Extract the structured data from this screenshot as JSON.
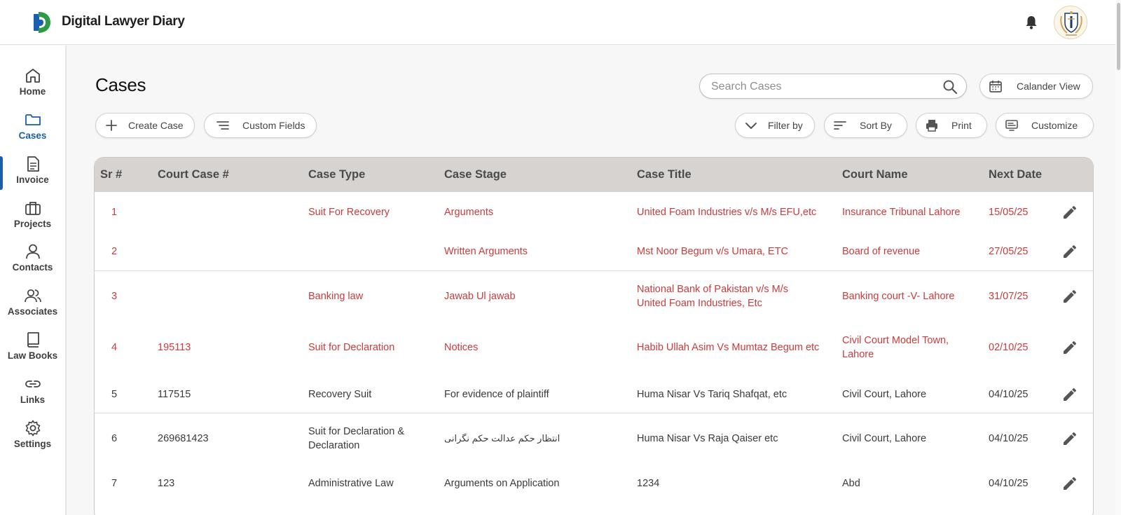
{
  "app": {
    "title": "Digital Lawyer Diary"
  },
  "sidebar": {
    "items": [
      {
        "label": "Home",
        "icon": "home-icon"
      },
      {
        "label": "Cases",
        "icon": "folder-icon",
        "active": true
      },
      {
        "label": "Invoice",
        "icon": "document-icon"
      },
      {
        "label": "Projects",
        "icon": "briefcase-icon"
      },
      {
        "label": "Contacts",
        "icon": "person-icon"
      },
      {
        "label": "Associates",
        "icon": "people-icon"
      },
      {
        "label": "Law Books",
        "icon": "book-icon"
      },
      {
        "label": "Links",
        "icon": "link-icon"
      },
      {
        "label": "Settings",
        "icon": "gear-icon"
      }
    ]
  },
  "page": {
    "title": "Cases"
  },
  "search": {
    "placeholder": "Search Cases",
    "value": ""
  },
  "toolbar": {
    "calendar_view": "Calander View",
    "create_case": "Create Case",
    "custom_fields": "Custom Fields",
    "filter_by": "Filter by",
    "sort_by": "Sort By",
    "print": "Print",
    "customize": "Customize"
  },
  "table": {
    "columns": [
      "Sr #",
      "Court Case #",
      "Case Type",
      "Case Stage",
      "Case Title",
      "Court Name",
      "Next Date"
    ],
    "rows": [
      {
        "sr": "1",
        "court_case": "",
        "case_type": "Suit For Recovery",
        "case_stage": "Arguments",
        "case_title": "United Foam Industries v/s M/s EFU,etc",
        "court_name": "Insurance Tribunal Lahore",
        "next_date": "15/05/25",
        "highlight": true
      },
      {
        "sr": "2",
        "court_case": "",
        "case_type": "",
        "case_stage": "Written Arguments",
        "case_title": "Mst Noor Begum v/s Umara, ETC",
        "court_name": "Board of revenue",
        "next_date": "27/05/25",
        "highlight": true
      },
      {
        "sr": "3",
        "court_case": "",
        "case_type": "Banking law",
        "case_stage": "Jawab Ul jawab",
        "case_title": "National Bank of Pakistan v/s M/s United Foam Industries, Etc",
        "court_name": "Banking court -V- Lahore",
        "next_date": "31/07/25",
        "highlight": true
      },
      {
        "sr": "4",
        "court_case": "195113",
        "case_type": "Suit for Declaration",
        "case_stage": "Notices",
        "case_title": "Habib Ullah Asim Vs Mumtaz Begum etc",
        "court_name": "Civil Court Model Town, Lahore",
        "next_date": "02/10/25",
        "highlight": true
      },
      {
        "sr": "5",
        "court_case": "117515",
        "case_type": "Recovery Suit",
        "case_stage": "For evidence of plaintiff",
        "case_title": "Huma Nisar Vs Tariq Shafqat, etc",
        "court_name": "Civil Court, Lahore",
        "next_date": "04/10/25",
        "highlight": false
      },
      {
        "sr": "6",
        "court_case": "269681423",
        "case_type": "Suit for Declaration & Declaration",
        "case_stage": "انتظار حکم عدالت حکم نگرانی",
        "case_title": "Huma Nisar Vs Raja Qaiser etc",
        "court_name": "Civil Court, Lahore",
        "next_date": "04/10/25",
        "highlight": false
      },
      {
        "sr": "7",
        "court_case": "123",
        "case_type": "Administrative Law",
        "case_stage": "Arguments on Application",
        "case_title": "1234",
        "court_name": "Abd",
        "next_date": "04/10/25",
        "highlight": false
      }
    ]
  },
  "colors": {
    "accent": "#1a5fa8",
    "highlight_text": "#cc3b3b",
    "header_bg": "#d6d3d1",
    "logo_blue": "#1c5fb0",
    "logo_green": "#2e9a48"
  }
}
